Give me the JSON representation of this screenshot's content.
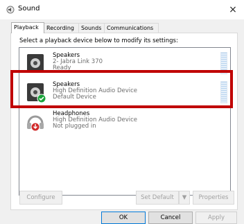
{
  "window": {
    "title": "Sound",
    "close_glyph": "×"
  },
  "tabs": [
    "Playback",
    "Recording",
    "Sounds",
    "Communications"
  ],
  "instruction": "Select a playback device below to modify its settings:",
  "devices": [
    {
      "name": "Speakers",
      "line1": "2- Jabra Link 370",
      "line2": "Ready",
      "icon": "speaker-icon"
    },
    {
      "name": "Speakers",
      "line1": "High Definition Audio Device",
      "line2": "Default Device",
      "icon": "speaker-default-icon"
    },
    {
      "name": "Headphones",
      "line1": "High Definition Audio Device",
      "line2": "Not plugged in",
      "icon": "headphones-unplugged-icon"
    }
  ],
  "buttons": {
    "configure": "Configure",
    "set_default": "Set Default",
    "set_default_arrow": "▼",
    "properties": "Properties",
    "ok": "OK",
    "cancel": "Cancel",
    "apply": "Apply"
  },
  "colors": {
    "highlight": "#c00000",
    "check": "#1aa33a",
    "unplug": "#d12b2b"
  }
}
